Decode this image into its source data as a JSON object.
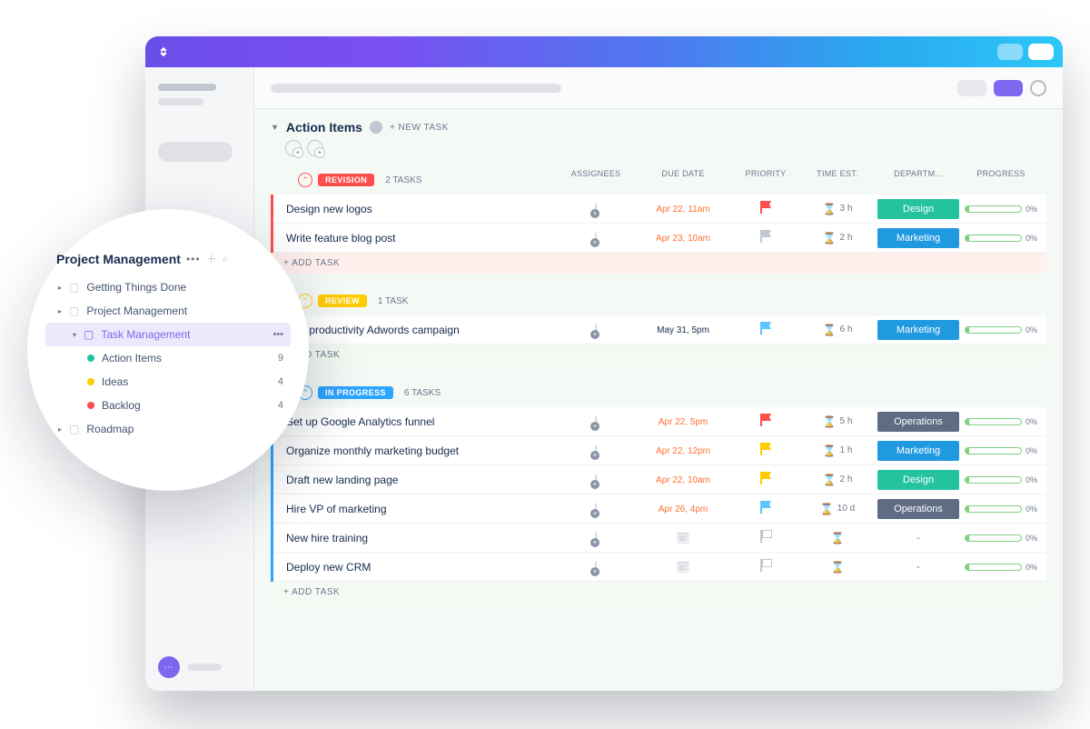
{
  "section": {
    "title": "Action Items",
    "new_task_label": "+ NEW TASK"
  },
  "columns": {
    "assignees": "ASSIGNEES",
    "due": "DUE DATE",
    "priority": "PRIORITY",
    "time": "TIME EST.",
    "dept": "DEPARTM...",
    "progress": "PROGRESS"
  },
  "groups": [
    {
      "key": "revision",
      "label": "REVISION",
      "count_label": "2 TASKS",
      "tasks": [
        {
          "title": "Design new logos",
          "due": "Apr 22, 11am",
          "due_color": "orange",
          "flag": "red",
          "time": "3 h",
          "dept": "Design",
          "dept_cls": "design",
          "progress": "0%"
        },
        {
          "title": "Write feature blog post",
          "due": "Apr 23, 10am",
          "due_color": "orange",
          "flag": "gray",
          "time": "2 h",
          "dept": "Marketing",
          "dept_cls": "marketing",
          "progress": "0%"
        }
      ],
      "add_label": "+ ADD TASK"
    },
    {
      "key": "review",
      "label": "REVIEW",
      "count_label": "1 TASK",
      "tasks": [
        {
          "title": "Run productivity Adwords campaign",
          "due": "May 31, 5pm",
          "due_color": "dark",
          "flag": "blue",
          "time": "6 h",
          "dept": "Marketing",
          "dept_cls": "marketing",
          "progress": "0%"
        }
      ],
      "add_label": "+ ADD TASK"
    },
    {
      "key": "inprogress",
      "label": "IN PROGRESS",
      "count_label": "6 TASKS",
      "tasks": [
        {
          "title": "Set up Google Analytics funnel",
          "due": "Apr 22, 5pm",
          "due_color": "orange",
          "flag": "red",
          "time": "5 h",
          "dept": "Operations",
          "dept_cls": "operations",
          "progress": "0%"
        },
        {
          "title": "Organize monthly marketing budget",
          "due": "Apr 22, 12pm",
          "due_color": "orange",
          "flag": "yellow",
          "time": "1 h",
          "dept": "Marketing",
          "dept_cls": "marketing",
          "progress": "0%"
        },
        {
          "title": "Draft new landing page",
          "due": "Apr 22, 10am",
          "due_color": "orange",
          "flag": "yellow",
          "time": "2 h",
          "dept": "Design",
          "dept_cls": "design",
          "progress": "0%"
        },
        {
          "title": "Hire VP of marketing",
          "due": "Apr 26, 4pm",
          "due_color": "orange",
          "flag": "blue",
          "time": "10 d",
          "dept": "Operations",
          "dept_cls": "operations",
          "progress": "0%"
        },
        {
          "title": "New hire training",
          "due": "",
          "due_color": "",
          "flag": "",
          "time": "",
          "dept": "-",
          "dept_cls": "none",
          "progress": "0%"
        },
        {
          "title": "Deploy new CRM",
          "due": "",
          "due_color": "",
          "flag": "",
          "time": "",
          "dept": "-",
          "dept_cls": "none",
          "progress": "0%"
        }
      ],
      "add_label": "+ ADD TASK"
    }
  ],
  "popover": {
    "title": "Project Management",
    "items": [
      {
        "level": 1,
        "icon": "folder",
        "label": "Getting Things Done",
        "selected": false,
        "right": ""
      },
      {
        "level": 1,
        "icon": "folder",
        "label": "Project Management",
        "selected": false,
        "right": ""
      },
      {
        "level": 2,
        "icon": "folder",
        "label": "Task Management",
        "selected": true,
        "right": "•••"
      },
      {
        "level": 3,
        "icon": "dot-teal",
        "label": "Action Items",
        "selected": false,
        "right": "9"
      },
      {
        "level": 3,
        "icon": "dot-yellow",
        "label": "Ideas",
        "selected": false,
        "right": "4"
      },
      {
        "level": 3,
        "icon": "dot-red",
        "label": "Backlog",
        "selected": false,
        "right": "4"
      },
      {
        "level": 1,
        "icon": "folder",
        "label": "Roadmap",
        "selected": false,
        "right": ""
      }
    ]
  },
  "flag_colors": {
    "red": "#ff4d4d",
    "yellow": "#ffcc00",
    "blue": "#5bc7ff",
    "gray": "#c1c7d0"
  }
}
